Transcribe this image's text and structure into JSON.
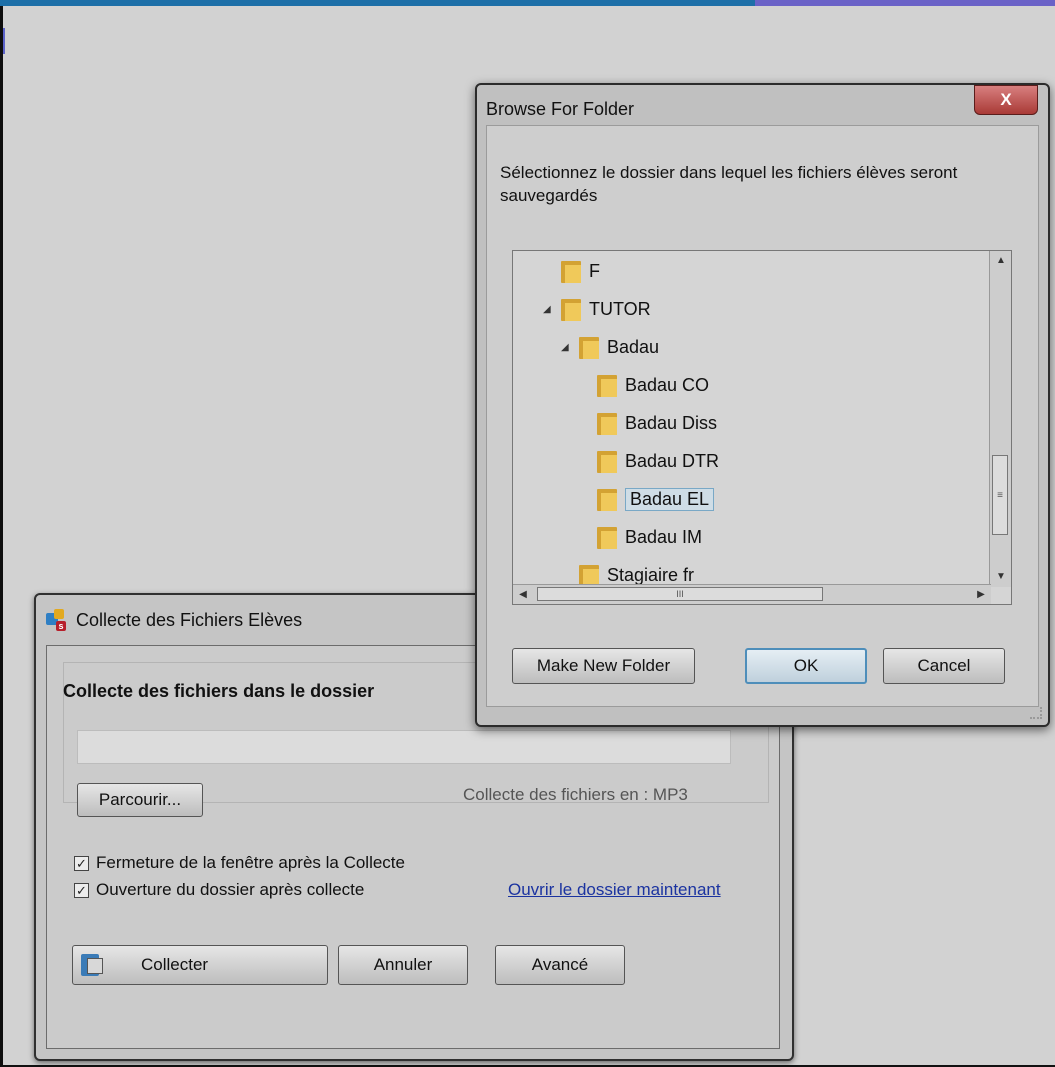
{
  "collecte_window": {
    "title": "Collecte des Fichiers Elèves",
    "group_title": "Collecte des fichiers dans le dossier",
    "path_value": "",
    "browse_button": "Parcourir...",
    "format_label": "Collecte des fichiers en :  MP3",
    "option_close_after": {
      "label": "Fermeture de la fenêtre après la Collecte",
      "checked": true
    },
    "option_open_folder": {
      "label": "Ouverture du dossier après collecte",
      "checked": true
    },
    "open_folder_link": "Ouvrir le dossier maintenant",
    "collect_button": "Collecter",
    "cancel_button": "Annuler",
    "advanced_button": "Avancé"
  },
  "browse_dialog": {
    "title": "Browse For Folder",
    "close_label": "X",
    "description": "Sélectionnez le dossier dans lequel les fichiers élèves seront sauvegardés",
    "tree": [
      {
        "label": "F",
        "expanded": false
      },
      {
        "label": "TUTOR",
        "expanded": true
      },
      {
        "label": "Badau",
        "expanded": true
      },
      {
        "label": "Badau CO",
        "expanded": false
      },
      {
        "label": "Badau Diss",
        "expanded": false
      },
      {
        "label": "Badau DTR",
        "expanded": false
      },
      {
        "label": "Badau EL",
        "expanded": false,
        "selected": true
      },
      {
        "label": "Badau IM",
        "expanded": false
      },
      {
        "label": "Stagiaire fr",
        "expanded": false
      }
    ],
    "make_new_folder_button": "Make New Folder",
    "ok_button": "OK",
    "cancel_button": "Cancel"
  },
  "colors": {
    "accent": "#1d6fa8",
    "close": "#a93a36",
    "link": "#1b33a0"
  },
  "icons": [
    "app-icon",
    "folder-icon",
    "checkbox-icon",
    "collect-icon",
    "close-icon"
  ]
}
